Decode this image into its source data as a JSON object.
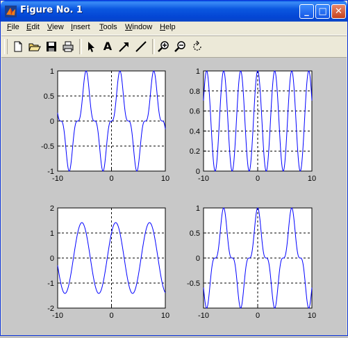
{
  "window": {
    "title": "Figure No. 1"
  },
  "window_buttons": {
    "minimize": "_",
    "maximize": "□",
    "close": "✕"
  },
  "menu": [
    {
      "label": "File",
      "key": "F"
    },
    {
      "label": "Edit",
      "key": "E"
    },
    {
      "label": "View",
      "key": "V"
    },
    {
      "label": "Insert",
      "key": "I"
    },
    {
      "label": "Tools",
      "key": "T"
    },
    {
      "label": "Window",
      "key": "W"
    },
    {
      "label": "Help",
      "key": "H"
    }
  ],
  "toolbar": {
    "buttons": [
      "new-figure-icon",
      "open-file-icon",
      "save-icon",
      "print-icon",
      "select-arrow-icon",
      "insert-text-icon",
      "insert-arrow-icon",
      "insert-line-icon",
      "zoom-in-icon",
      "zoom-out-icon",
      "rotate-3d-icon"
    ],
    "text_tool_label": "A"
  },
  "colors": {
    "line": "#0000ff",
    "axes_bg": "#ffffff",
    "figure_bg": "#c8c8c8",
    "grid": "#000000"
  },
  "chart_data": [
    {
      "type": "line",
      "xlim": [
        -10,
        10
      ],
      "ylim": [
        -1,
        1
      ],
      "xticks": [
        -10,
        0,
        10
      ],
      "yticks": [
        1,
        0.5,
        0,
        -0.5,
        -1
      ],
      "xtick_labels": [
        "-10",
        "0",
        "10"
      ],
      "ytick_labels": [
        "1",
        "0.5",
        "0",
        "-0.5",
        "-1"
      ],
      "grid": "dashed lines at x=0 and each y tick",
      "series": [
        {
          "func": "sin(x)^3",
          "x_range": [
            -10,
            10
          ]
        }
      ]
    },
    {
      "type": "line",
      "xlim": [
        -10,
        10
      ],
      "ylim": [
        0,
        1
      ],
      "xticks": [
        -10,
        0,
        10
      ],
      "yticks": [
        1,
        0.8,
        0.6,
        0.4,
        0.2,
        0
      ],
      "xtick_labels": [
        "-10",
        "0",
        "10"
      ],
      "ytick_labels": [
        "1",
        "0.8",
        "0.6",
        "0.4",
        "0.2",
        "0"
      ],
      "grid": "dashed lines at x=0 and each y tick",
      "series": [
        {
          "func": "cos(x)^2",
          "x_range": [
            -10,
            10
          ]
        }
      ]
    },
    {
      "type": "line",
      "xlim": [
        -10,
        10
      ],
      "ylim": [
        -2,
        2
      ],
      "xticks": [
        -10,
        0,
        10
      ],
      "yticks": [
        2,
        1,
        0,
        -1,
        -2
      ],
      "xtick_labels": [
        "-10",
        "0",
        "10"
      ],
      "ytick_labels": [
        "2",
        "1",
        "0",
        "-1",
        "-2"
      ],
      "grid": "dashed lines at x=0 and each y tick",
      "series": [
        {
          "func": "sin(x)+cos(x)",
          "x_range": [
            -10,
            10
          ]
        }
      ]
    },
    {
      "type": "line",
      "xlim": [
        -10,
        10
      ],
      "ylim": [
        -1,
        1
      ],
      "xticks": [
        -10,
        0,
        10
      ],
      "yticks": [
        1,
        0.5,
        0,
        -0.5
      ],
      "xtick_labels": [
        "-10",
        "0",
        "10"
      ],
      "ytick_labels": [
        "1",
        "0.5",
        "0",
        "-0.5"
      ],
      "grid": "dashed lines at x=0 and each y tick",
      "series": [
        {
          "func": "sin(x)^2 * cos(x) ... approx cos(x)^3",
          "x_range": [
            -10,
            10
          ]
        }
      ]
    }
  ]
}
